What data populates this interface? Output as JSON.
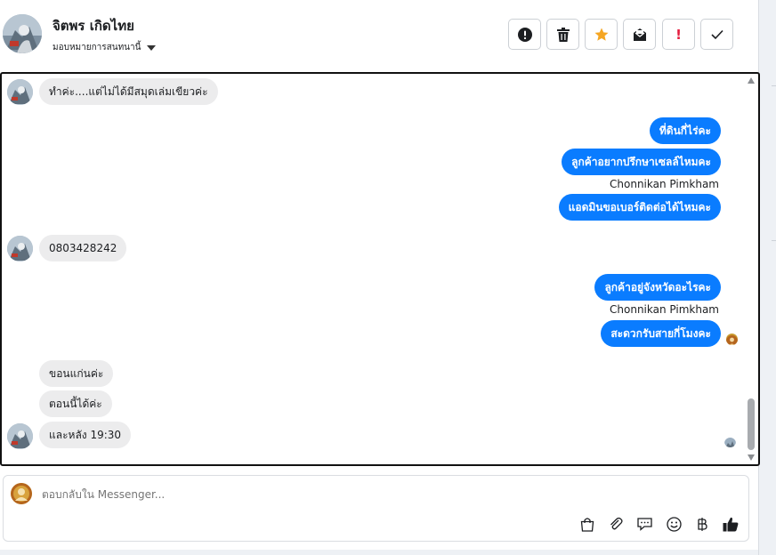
{
  "header": {
    "contact_name": "จิตพร เกิดไทย",
    "assign_label": "มอบหมายการสนทนานี้"
  },
  "toolbar": {
    "buttons": [
      {
        "name": "report-icon",
        "label": "!"
      },
      {
        "name": "trash-icon"
      },
      {
        "name": "star-icon"
      },
      {
        "name": "mark-unread-icon"
      },
      {
        "name": "important-icon",
        "label": "!"
      },
      {
        "name": "done-icon"
      }
    ]
  },
  "conversation": {
    "messages": [
      {
        "dir": "in",
        "text": "ทำค่ะ....แต่ไม่ได้มีสมุดเล่มเขียวค่ะ"
      },
      {
        "dir": "out",
        "text": "ที่ดินกี่ไร่คะ"
      },
      {
        "dir": "out",
        "text": "ลูกค้าอยากปรึกษาเซลล์ไหมคะ"
      },
      {
        "dir": "out",
        "text": "แอดมินขอเบอร์ติดต่อได้ไหมคะ"
      },
      {
        "dir": "in",
        "text": "0803428242"
      },
      {
        "dir": "out",
        "text": "ลูกค้าอยู่จังหวัดอะไรคะ"
      },
      {
        "dir": "out",
        "text": "สะดวกรับสายกี่โมงคะ"
      },
      {
        "dir": "in",
        "text": "ขอนแก่นค่ะ"
      },
      {
        "dir": "in",
        "text": "ตอนนี้ได้ค่ะ"
      },
      {
        "dir": "in",
        "text": "และหลัง 19:30"
      }
    ],
    "senders": [
      "Chonnikan Pimkham",
      "Chonnikan Pimkham"
    ]
  },
  "reply": {
    "placeholder": "ตอบกลับใน Messenger...",
    "icons": [
      "shopping-bag-icon",
      "attachment-icon",
      "saved-reply-icon",
      "emoji-icon",
      "baht-icon",
      "like-icon"
    ]
  },
  "colors": {
    "outgoing_bubble": "#0a7cff",
    "incoming_bubble": "#ececed",
    "star": "#f5a623",
    "important": "#e41e3f"
  }
}
